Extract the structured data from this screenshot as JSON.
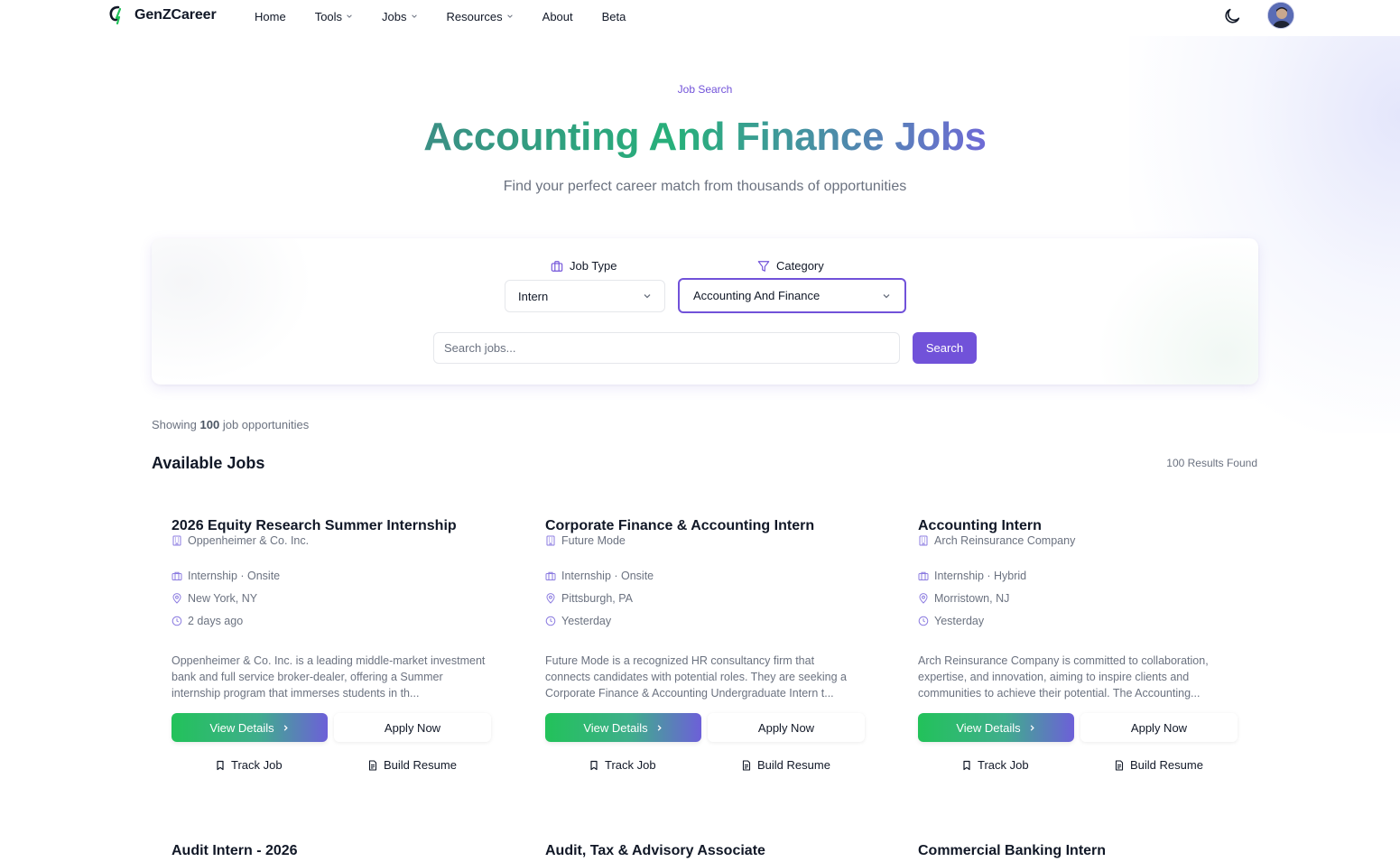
{
  "nav": {
    "brand": "GenZCareer",
    "items": [
      {
        "label": "Home",
        "dropdown": false
      },
      {
        "label": "Tools",
        "dropdown": true
      },
      {
        "label": "Jobs",
        "dropdown": true
      },
      {
        "label": "Resources",
        "dropdown": true
      },
      {
        "label": "About",
        "dropdown": false
      },
      {
        "label": "Beta",
        "dropdown": false
      }
    ],
    "theme_icon": "moon-icon"
  },
  "hero": {
    "eyebrow": "Job Search",
    "title": "Accounting And Finance Jobs",
    "subtitle": "Find your perfect career match from thousands of opportunities"
  },
  "filters": {
    "job_type_label": "Job Type",
    "job_type_value": "Intern",
    "category_label": "Category",
    "category_value": "Accounting And Finance",
    "search_placeholder": "Search jobs...",
    "search_value": "",
    "search_button": "Search"
  },
  "results": {
    "showing_prefix": "Showing",
    "showing_count": "100",
    "showing_suffix": "job opportunities",
    "section_title": "Available Jobs",
    "results_count": "100 Results Found"
  },
  "job_actions": {
    "view": "View Details",
    "apply": "Apply Now",
    "track": "Track Job",
    "resume": "Build Resume"
  },
  "jobs": [
    {
      "title": "2026 Equity Research Summer Internship",
      "company": "Oppenheimer & Co. Inc.",
      "type": "Internship · Onsite",
      "location": "New York, NY",
      "posted": "2 days ago",
      "description": "Oppenheimer & Co. Inc. is a leading middle-market investment bank and full service broker-dealer, offering a Summer internship program that immerses students in th..."
    },
    {
      "title": "Corporate Finance & Accounting Intern",
      "company": "Future Mode",
      "type": "Internship · Onsite",
      "location": "Pittsburgh, PA",
      "posted": "Yesterday",
      "description": "Future Mode is a recognized HR consultancy firm that connects candidates with potential roles. They are seeking a Corporate Finance & Accounting Undergraduate Intern t..."
    },
    {
      "title": "Accounting Intern",
      "company": "Arch Reinsurance Company",
      "type": "Internship · Hybrid",
      "location": "Morristown, NJ",
      "posted": "Yesterday",
      "description": "Arch Reinsurance Company is committed to collaboration, expertise, and innovation, aiming to inspire clients and communities to achieve their potential. The Accounting..."
    },
    {
      "title": "Audit Intern - 2026"
    },
    {
      "title": "Audit, Tax & Advisory Associate"
    },
    {
      "title": "Commercial Banking Intern"
    }
  ],
  "colors": {
    "accent": "#7152d9",
    "gradient_start": "#22c25a",
    "gradient_end": "#6d5fd8",
    "muted_text": "#6b7280"
  }
}
